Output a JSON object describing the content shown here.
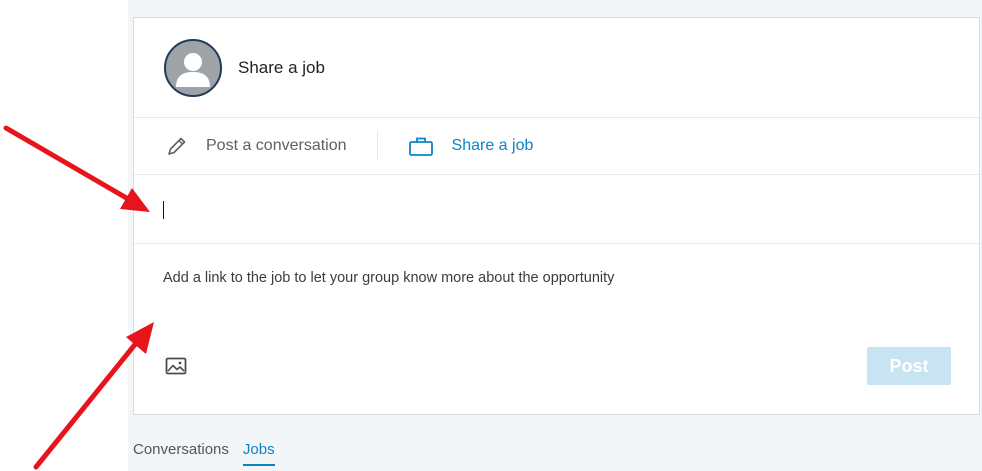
{
  "header": {
    "title": "Share a job"
  },
  "mode_tabs": [
    {
      "label": "Post a conversation",
      "icon": "pencil-icon",
      "active": false
    },
    {
      "label": "Share a job",
      "icon": "briefcase-icon",
      "active": true
    }
  ],
  "composer": {
    "title_value": "",
    "description_placeholder": "Add a link to the job to let your group know more about the opportunity",
    "image_icon": "image-icon",
    "post_label": "Post"
  },
  "feed_tabs": [
    {
      "label": "Conversations",
      "active": false
    },
    {
      "label": "Jobs",
      "active": true
    }
  ],
  "colors": {
    "accent": "#0a84c6",
    "post_disabled": "#c8e3f2",
    "annotation_arrow": "#e8141b"
  }
}
